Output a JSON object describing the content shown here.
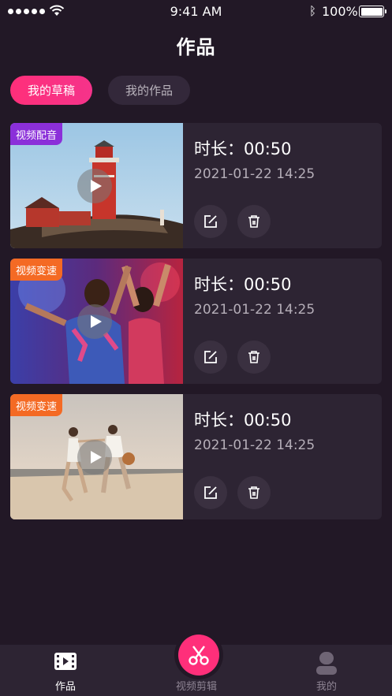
{
  "status_bar": {
    "time": "9:41 AM",
    "battery_percent": "100%",
    "signal_bars": 5
  },
  "header": {
    "title": "作品"
  },
  "tabs": [
    {
      "label": "我的草稿",
      "active": true
    },
    {
      "label": "我的作品",
      "active": false
    }
  ],
  "works": [
    {
      "tag": "视频配音",
      "tag_color": "#8b2fd9",
      "duration": "时长：00:50",
      "date": "2021-01-22 14:25",
      "thumbnail": "lighthouse"
    },
    {
      "tag": "视频变速",
      "tag_color": "#f46a24",
      "duration": "时长：00:50",
      "date": "2021-01-22 14:25",
      "thumbnail": "party"
    },
    {
      "tag": "视频变速",
      "tag_color": "#f46a24",
      "duration": "时长：00:50",
      "date": "2021-01-22 14:25",
      "thumbnail": "beach"
    }
  ],
  "bottom_nav": {
    "items": [
      {
        "label": "作品",
        "icon": "film-icon",
        "active": true
      },
      {
        "label": "视频剪辑",
        "icon": "scissors-icon",
        "active": false
      },
      {
        "label": "我的",
        "icon": "user-icon",
        "active": false
      }
    ]
  },
  "colors": {
    "background": "#221826",
    "card": "#2d2433",
    "accent": "#ff2f7a"
  }
}
